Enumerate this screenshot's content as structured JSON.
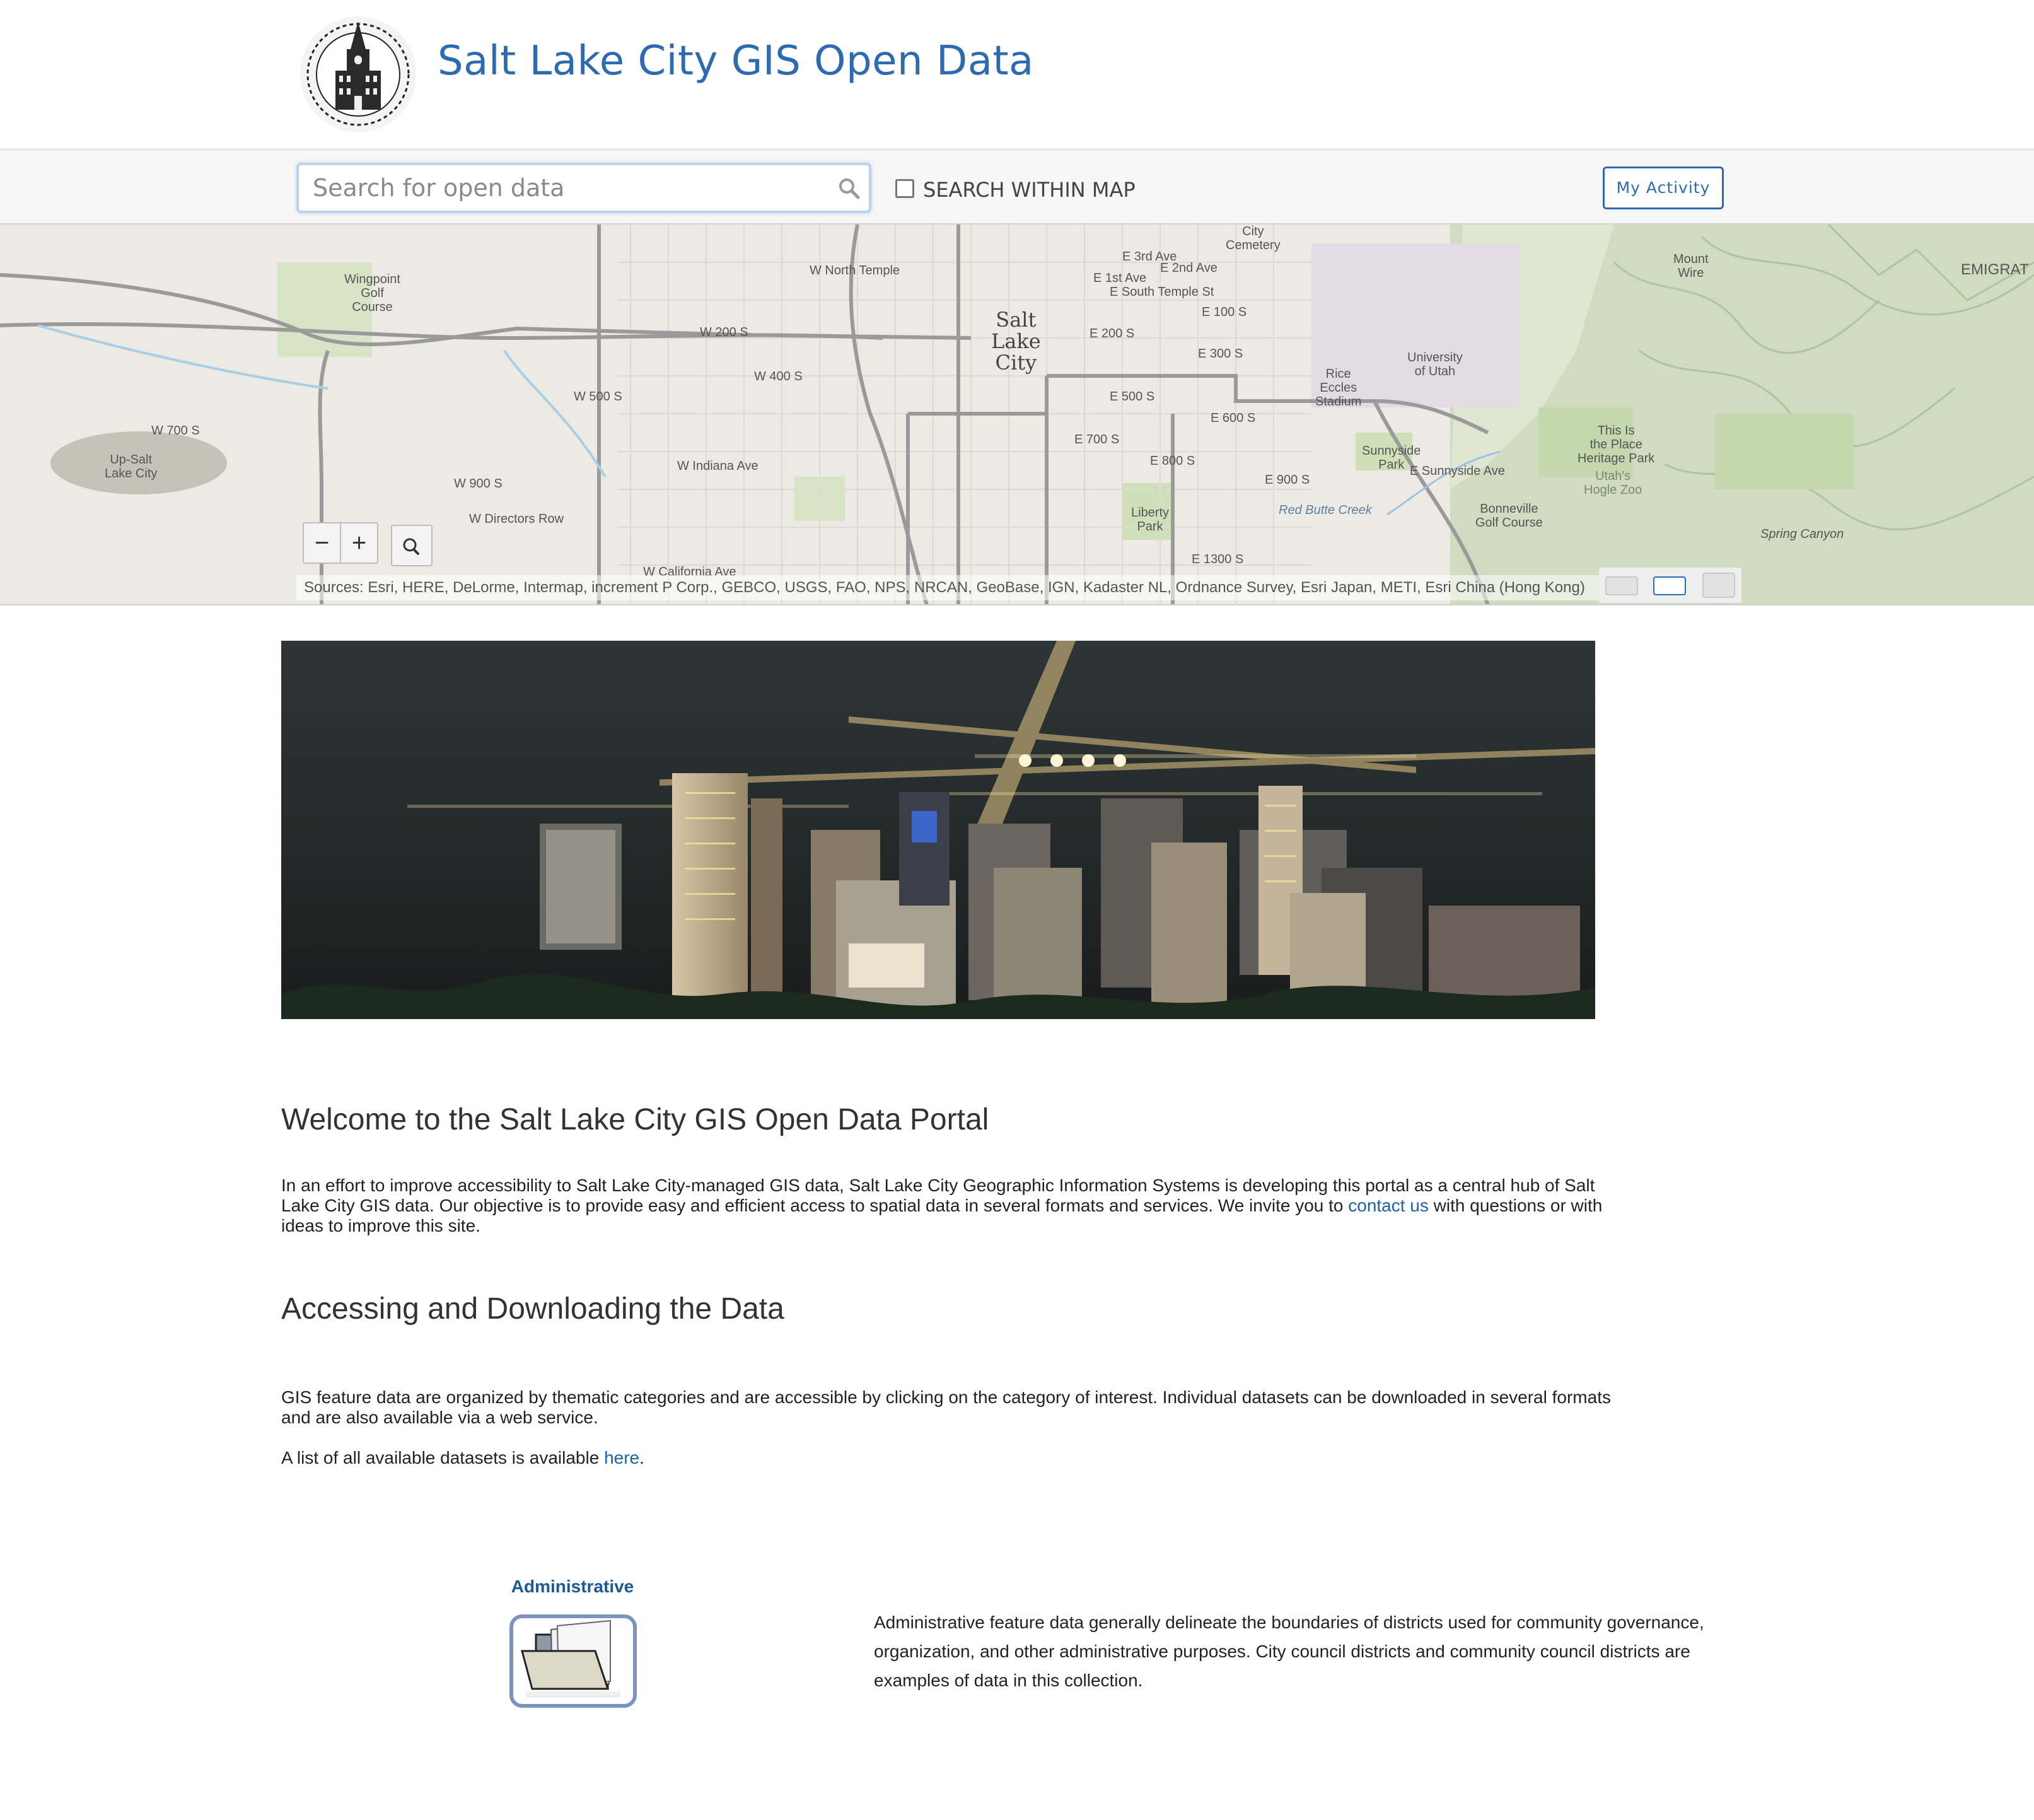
{
  "header": {
    "title": "Salt Lake City GIS Open Data",
    "logo_icon": "city-seal-icon"
  },
  "search": {
    "placeholder": "Search for open data",
    "value": "",
    "within_map_label": "SEARCH WITHIN MAP",
    "within_map_checked": false,
    "my_activity_label": "My Activity"
  },
  "map": {
    "city_label": "Salt\nLake\nCity",
    "streets": {
      "north_temple": "W North Temple",
      "w200s": "W 200 S",
      "w400s": "W 400 S",
      "w500s": "W 500 S",
      "w700s": "W 700 S",
      "w900s": "W 900 S",
      "indiana": "W Indiana Ave",
      "directors": "W Directors Row",
      "california": "W California Ave",
      "e500s": "E 500 S",
      "e600s": "E 600 S",
      "e700s": "E 700 S",
      "e800s": "E 800 S",
      "e900s": "E 900 S",
      "e1300s": "E 1300 S",
      "e300s": "E 300 S",
      "e200s": "E 200 S",
      "e100s": "E 100 S",
      "sunnyside": "E Sunnyside Ave",
      "south_temple": "E South Temple St",
      "e1st": "E 1st Ave",
      "e2nd": "E 2nd Ave",
      "e3rd": "E 3rd Ave"
    },
    "places": {
      "wingpoint": "Wingpoint\nGolf\nCourse",
      "upsalt": "Up-Salt\nLake City",
      "university": "University\nof Utah",
      "rice": "Rice\nEccles\nStadium",
      "sunnyside_park": "Sunnyside\nPark",
      "place": "This Is\nthe Place\nHeritage Park",
      "hogle": "Utah's\nHogle Zoo",
      "bonneville": "Bonneville\nGolf Course",
      "liberty": "Liberty\nPark",
      "mount_wire": "Mount\nWire",
      "spring_canyon": "Spring Canyon",
      "red_butte": "Red Butte Creek",
      "emigration": "EMIGRAT",
      "cemetery": "City\nCemetery"
    },
    "zoom_out": "−",
    "zoom_in": "+",
    "attribution": "Sources: Esri, HERE, DeLorme, Intermap, increment P Corp., GEBCO, USGS, FAO, NPS, NRCAN, GeoBase, IGN, Kadaster NL, Ordnance Survey, Esri Japan, METI, Esri China (Hong Kong)"
  },
  "content": {
    "welcome_heading": "Welcome to the Salt Lake City GIS Open Data Portal",
    "welcome_text_a": "In an effort to improve accessibility to Salt Lake City-managed GIS data, Salt Lake City Geographic Information Systems is developing this portal as a central hub of Salt Lake City GIS data. Our objective is to provide easy and efficient access to spatial data in several formats and services. We invite you to ",
    "contact_link": "contact us",
    "welcome_text_b": " with questions or with ideas to improve this site.",
    "access_heading": "Accessing and Downloading the Data",
    "access_text": "GIS feature data are organized by thematic categories and are accessible by clicking on the category of interest. Individual datasets can be downloaded in several formats and are also available via a web service.",
    "list_text_a": "A list of all available datasets is available ",
    "here_link": "here",
    "list_text_b": "."
  },
  "category": {
    "title": "Administrative",
    "icon": "folder-icon",
    "description": "Administrative feature data generally delineate the boundaries of districts used for community governance, organization, and other administrative purposes. City council districts and community council districts are examples of data in this collection."
  }
}
